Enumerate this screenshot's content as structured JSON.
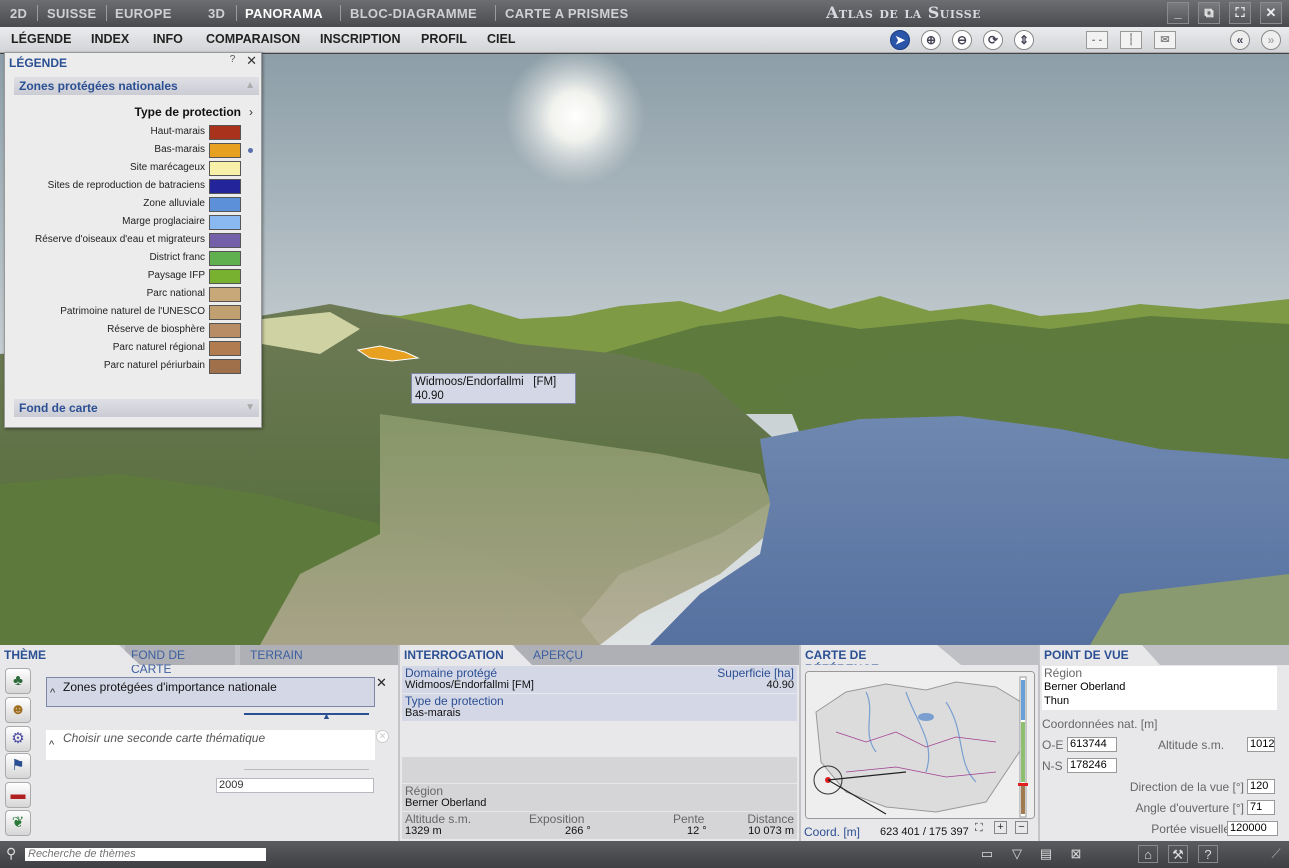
{
  "topnav": {
    "d2": "2D",
    "suisse": "SUISSE",
    "europe": "EUROPE",
    "d3": "3D",
    "panorama": "PANORAMA",
    "bloc": "BLOC-DIAGRAMME",
    "prismes": "CARTE A PRISMES"
  },
  "brand": "Atlas de la Suisse",
  "menu": {
    "legende": "LÉGENDE",
    "index": "INDEX",
    "info": "INFO",
    "comparaison": "COMPARAISON",
    "inscription": "INSCRIPTION",
    "profil": "PROFIL",
    "ciel": "CIEL"
  },
  "legend": {
    "title": "LÉGENDE",
    "help": "?",
    "section": "Zones protégées nationales",
    "type_label": "Type de protection",
    "items": [
      {
        "label": "Haut-marais",
        "color": "#a8321c"
      },
      {
        "label": "Bas-marais",
        "color": "#e8a020"
      },
      {
        "label": "Site marécageux",
        "color": "#f7f0a8"
      },
      {
        "label": "Sites de reproduction de batraciens",
        "color": "#24249a"
      },
      {
        "label": "Zone alluviale",
        "color": "#5c90d8"
      },
      {
        "label": "Marge proglaciaire",
        "color": "#8ab8f0"
      },
      {
        "label": "Réserve d'oiseaux d'eau et migrateurs",
        "color": "#7460a8"
      },
      {
        "label": "District franc",
        "color": "#60b050"
      },
      {
        "label": "Paysage IFP",
        "color": "#78b030"
      },
      {
        "label": "Parc national",
        "color": "#c8a878"
      },
      {
        "label": "Patrimoine naturel de l'UNESCO",
        "color": "#c0a070"
      },
      {
        "label": "Réserve de biosphère",
        "color": "#b88c64"
      },
      {
        "label": "Parc naturel régional",
        "color": "#b07c50"
      },
      {
        "label": "Parc naturel périurbain",
        "color": "#a0704a"
      }
    ],
    "footer": "Fond de carte"
  },
  "tooltip": {
    "name": "Widmoos/Endorfallmi",
    "code": "[FM]",
    "value": "40.90"
  },
  "theme": {
    "tab_theme": "THÈME",
    "tab_fond": "FOND DE CARTE",
    "tab_terrain": "TERRAIN",
    "selected": "Zones protégées d'importance nationale",
    "second_placeholder": "Choisir une seconde carte thématique",
    "year": "2009"
  },
  "interrogation": {
    "tab": "INTERROGATION",
    "tab2": "APERÇU",
    "domaine_label": "Domaine protégé",
    "superficie_label": "Superficie [ha]",
    "domaine_value": "Widmoos/Endorfallmi   [FM]",
    "superficie_value": "40.90",
    "type_label": "Type de protection",
    "type_value": "Bas-marais",
    "region_label": "Région",
    "region_value": "Berner Oberland",
    "alt_label": "Altitude s.m.",
    "alt_value": "1329 m",
    "expo_label": "Exposition",
    "expo_value": "266 °",
    "pente_label": "Pente",
    "pente_value": "12 °",
    "dist_label": "Distance",
    "dist_value": "10 073 m"
  },
  "reference": {
    "tab": "CARTE DE RÉFÉRENCE",
    "coord_label": "Coord. [m]",
    "coord_value": "623 401 / 175 397"
  },
  "pointdevue": {
    "tab": "POINT DE VUE",
    "region_label": "Région",
    "region1": "Berner Oberland",
    "region2": "Thun",
    "coords_label": "Coordonnées nat. [m]",
    "oe_label": "O-E",
    "oe_value": "613744",
    "ns_label": "N-S",
    "ns_value": "178246",
    "alt_label": "Altitude s.m.",
    "alt_value": "1012",
    "dir_label": "Direction de la vue [°]",
    "dir_value": "120",
    "angle_label": "Angle d'ouverture [°]",
    "angle_value": "71",
    "portee_label": "Portée visuelle",
    "portee_value": "120000"
  },
  "status": {
    "search_placeholder": "Recherche de thèmes"
  }
}
